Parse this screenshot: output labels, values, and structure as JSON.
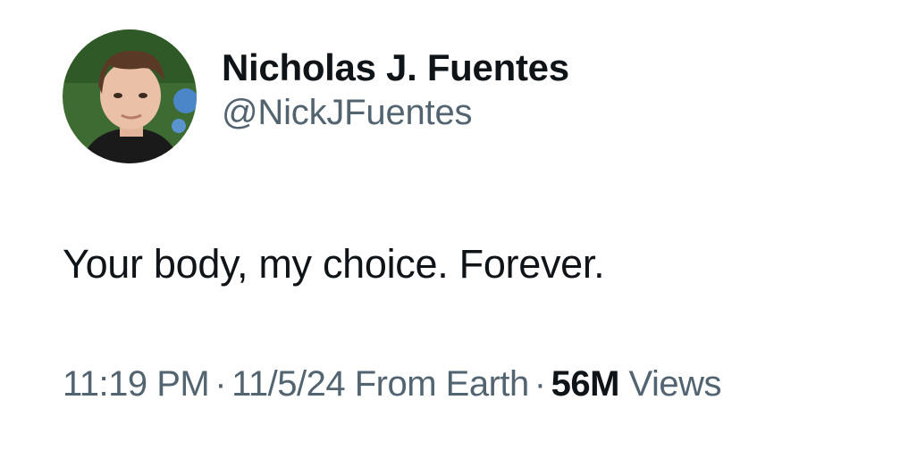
{
  "author": {
    "display_name": "Nicholas J. Fuentes",
    "handle": "@NickJFuentes",
    "avatar": "profile-photo"
  },
  "tweet": {
    "text": "Your body, my choice. Forever."
  },
  "meta": {
    "time": "11:19 PM",
    "separator_1": "·",
    "date": "11/5/24",
    "source": "From Earth",
    "separator_2": "·",
    "views_count": "56M",
    "views_label": "Views"
  },
  "colors": {
    "primary_text": "#0f1419",
    "secondary_text": "#536471",
    "background": "#ffffff"
  }
}
